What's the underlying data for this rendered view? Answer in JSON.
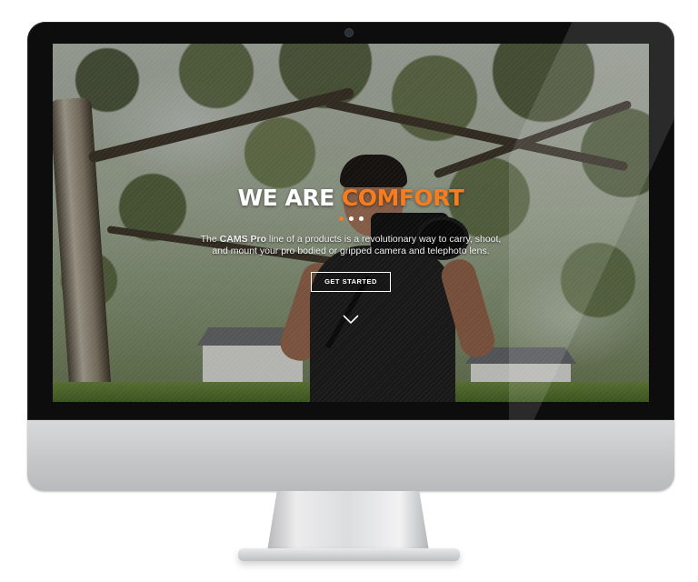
{
  "hero": {
    "headline_white": "WE ARE",
    "headline_accent": "COMFORT",
    "description_prefix": "The",
    "description_brand": "CAMS Pro",
    "description_body": "line of a products is a revolutionary way to carry, shoot, and mount your pro bodied or gripped camera and telephoto lens.",
    "cta_label": "GET STARTED",
    "slides_total": 3,
    "slide_active": 1
  },
  "colors": {
    "accent": "#f57c1f",
    "text": "#ffffff"
  },
  "icons": {
    "scroll": "chevron-down-icon",
    "webcam": "webcam-icon"
  }
}
